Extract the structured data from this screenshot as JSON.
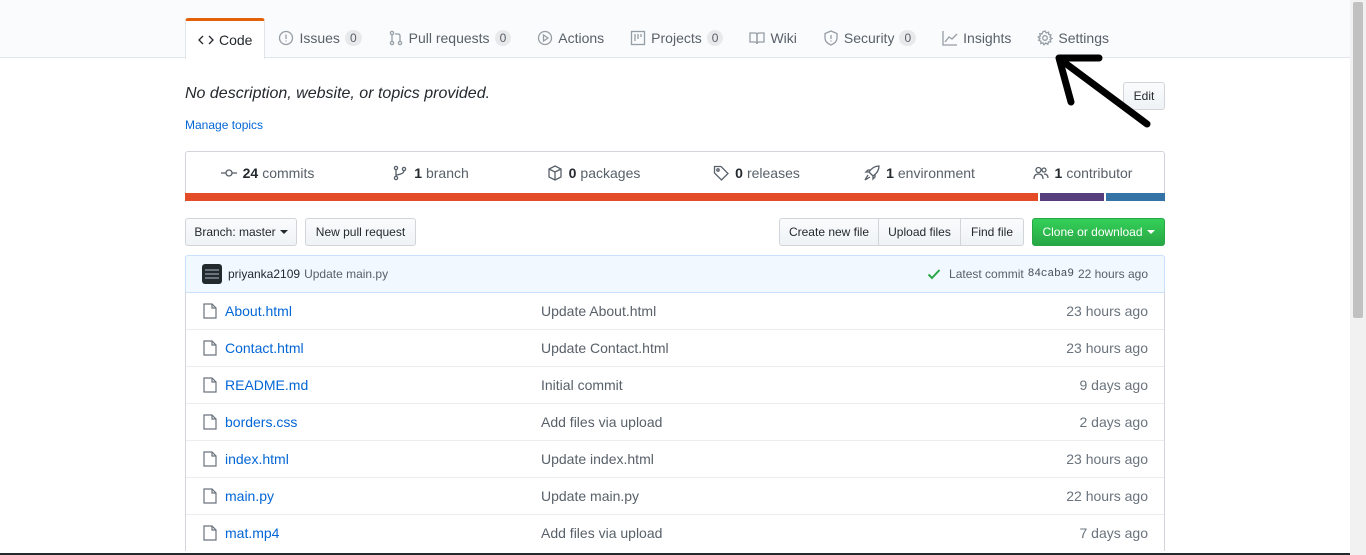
{
  "nav": {
    "code": "Code",
    "issues": "Issues",
    "issues_count": "0",
    "pulls": "Pull requests",
    "pulls_count": "0",
    "actions": "Actions",
    "projects": "Projects",
    "projects_count": "0",
    "wiki": "Wiki",
    "security": "Security",
    "security_count": "0",
    "insights": "Insights",
    "settings": "Settings"
  },
  "repo": {
    "description": "No description, website, or topics provided.",
    "manage_topics": "Manage topics",
    "edit": "Edit"
  },
  "summary": {
    "commits_num": "24",
    "commits_label": "commits",
    "branch_num": "1",
    "branch_label": "branch",
    "packages_num": "0",
    "packages_label": "packages",
    "releases_num": "0",
    "releases_label": "releases",
    "environment_num": "1",
    "environment_label": "environment",
    "contributor_num": "1",
    "contributor_label": "contributor"
  },
  "languages": [
    {
      "color": "#e34c26",
      "fraction": 0.87
    },
    {
      "color": "#563d7c",
      "fraction": 0.068
    },
    {
      "color": "#3572a5",
      "fraction": 0.062
    }
  ],
  "toolbar": {
    "branch": "Branch: master",
    "new_pr": "New pull request",
    "create_file": "Create new file",
    "upload_files": "Upload files",
    "find_file": "Find file",
    "clone": "Clone or download"
  },
  "latest_commit": {
    "author": "priyanka2109",
    "message": "Update main.py",
    "prefix": "Latest commit",
    "sha": "84caba9",
    "age": "22 hours ago"
  },
  "files": [
    {
      "name": "About.html",
      "message": "Update About.html",
      "age": "23 hours ago"
    },
    {
      "name": "Contact.html",
      "message": "Update Contact.html",
      "age": "23 hours ago"
    },
    {
      "name": "README.md",
      "message": "Initial commit",
      "age": "9 days ago"
    },
    {
      "name": "borders.css",
      "message": "Add files via upload",
      "age": "2 days ago"
    },
    {
      "name": "index.html",
      "message": "Update index.html",
      "age": "23 hours ago"
    },
    {
      "name": "main.py",
      "message": "Update main.py",
      "age": "22 hours ago"
    },
    {
      "name": "mat.mp4",
      "message": "Add files via upload",
      "age": "7 days ago"
    }
  ],
  "colors": {
    "accent_tab": "#e36209",
    "link": "#0366d6",
    "primary_button": "#28a745"
  }
}
